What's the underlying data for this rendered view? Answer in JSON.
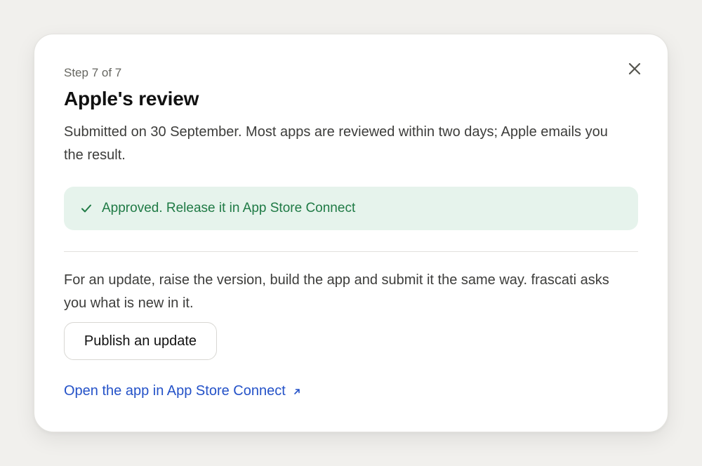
{
  "dialog": {
    "step": "Step 7 of 7",
    "title": "Apple's review",
    "description": "Submitted on 30 September. Most apps are reviewed within two days; Apple emails you the result.",
    "status": {
      "text": "Approved. Release it in App Store Connect",
      "icon": "check-icon",
      "color": "#1f7a45",
      "background": "#e6f3ec"
    },
    "update_text": "For an update, raise the version, build the app and submit it the same way. frascati asks you what is new in it.",
    "publish_button": "Publish an update",
    "open_link": "Open the app in App Store Connect",
    "link_icon": "external-link-icon",
    "close_icon": "close-icon",
    "link_color": "#2452c8"
  }
}
